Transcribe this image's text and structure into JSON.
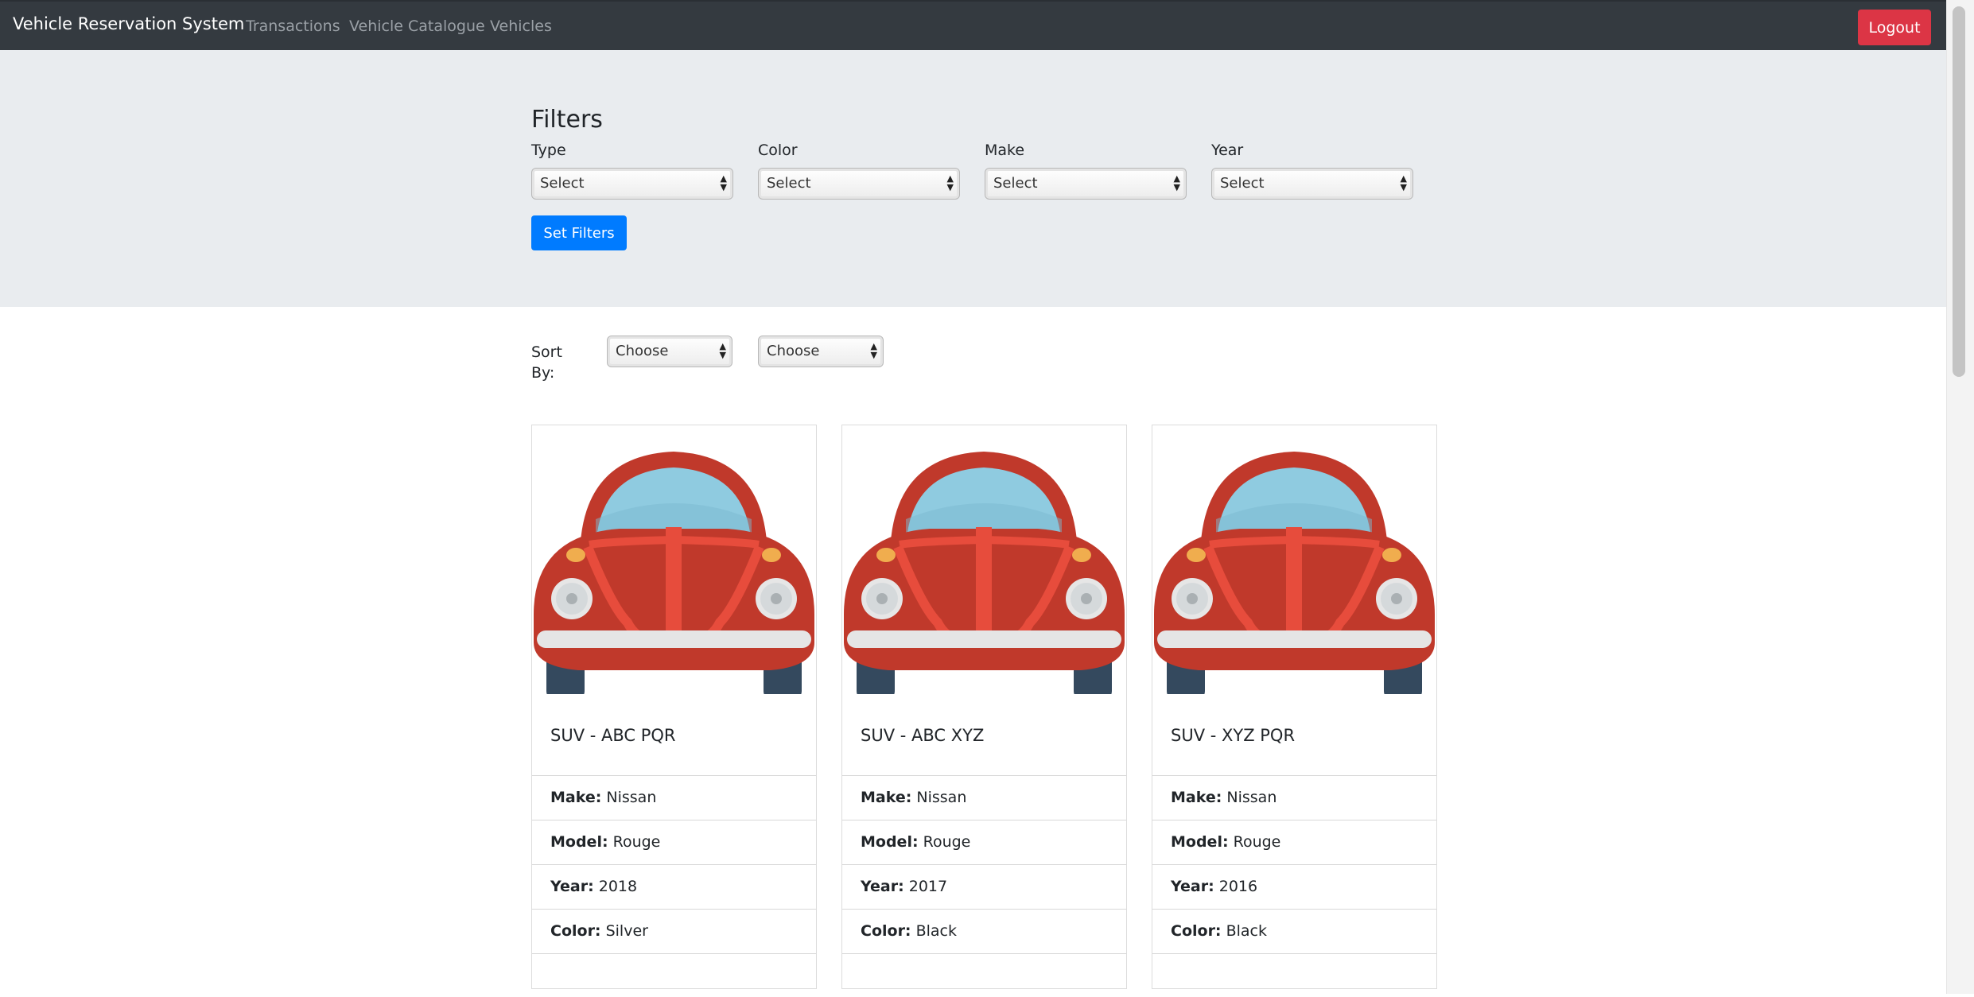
{
  "navbar": {
    "brand": "Vehicle Reservation System",
    "links": [
      "Transactions",
      "Vehicle Catalogue",
      "Vehicles"
    ],
    "logout_label": "Logout"
  },
  "filters": {
    "title": "Filters",
    "fields": [
      {
        "label": "Type",
        "value": "Select"
      },
      {
        "label": "Color",
        "value": "Select"
      },
      {
        "label": "Make",
        "value": "Select"
      },
      {
        "label": "Year",
        "value": "Select"
      }
    ],
    "submit_label": "Set Filters"
  },
  "sort": {
    "label": "Sort By:",
    "selects": [
      "Choose",
      "Choose"
    ]
  },
  "vehicles": [
    {
      "title": "SUV - ABC PQR",
      "make": "Nissan",
      "model": "Rouge",
      "year": "2018",
      "color": "Silver"
    },
    {
      "title": "SUV - ABC XYZ",
      "make": "Nissan",
      "model": "Rouge",
      "year": "2017",
      "color": "Black"
    },
    {
      "title": "SUV - XYZ PQR",
      "make": "Nissan",
      "model": "Rouge",
      "year": "2016",
      "color": "Black"
    }
  ],
  "field_labels": {
    "make": "Make:",
    "model": "Model:",
    "year": "Year:",
    "color": "Color:"
  },
  "colors": {
    "navbar": "#343a40",
    "danger": "#dc3545",
    "primary": "#007bff",
    "jumbotron": "#e9ecef",
    "car_body": "#c0392b",
    "car_window": "#8fcbe0"
  }
}
